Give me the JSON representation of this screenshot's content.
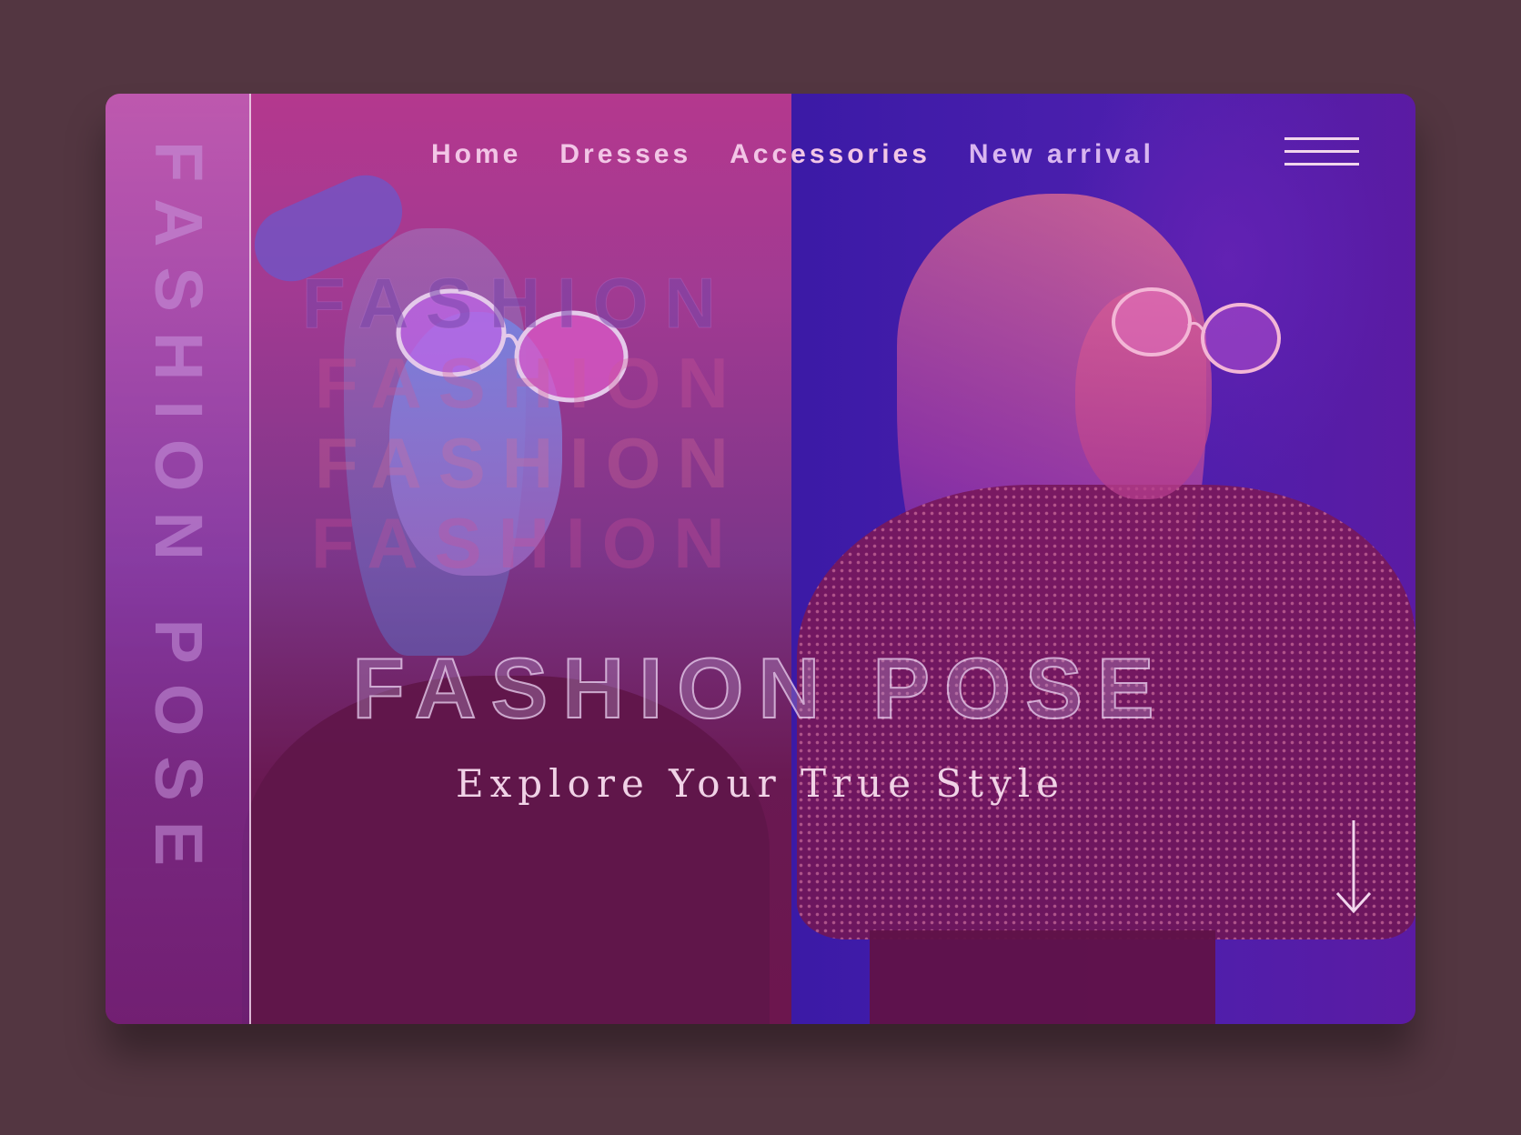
{
  "side": {
    "vertical_text": "FASHION POSE"
  },
  "nav": {
    "items": [
      {
        "label": "Home"
      },
      {
        "label": "Dresses"
      },
      {
        "label": "Accessories"
      },
      {
        "label": "New arrival"
      }
    ]
  },
  "ghost_words": [
    "FASHION",
    "FASHION",
    "FASHION",
    "FASHION"
  ],
  "hero": {
    "title": "FASHION POSE",
    "subtitle": "Explore Your True Style"
  },
  "icons": {
    "menu": "hamburger-menu-icon",
    "scroll": "arrow-down-icon"
  },
  "colors": {
    "background": "#533641",
    "nav_text": "#f2c6e6",
    "accent_pink": "#b4388e",
    "accent_violet": "#4c1fae"
  }
}
